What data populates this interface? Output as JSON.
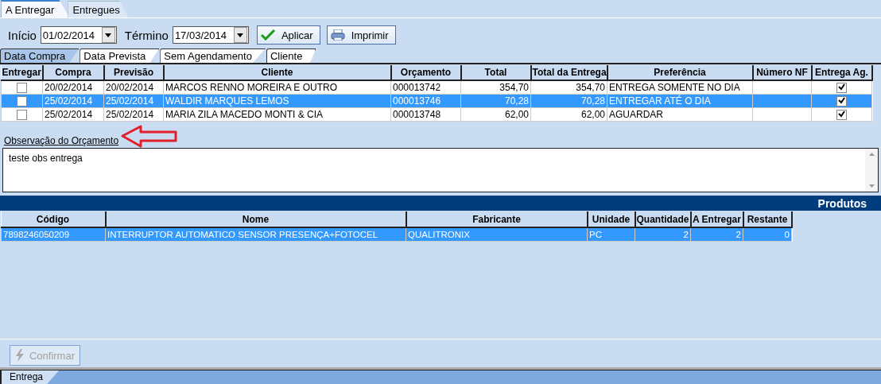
{
  "main_tabs": [
    {
      "label": "A Entregar",
      "selected": true
    },
    {
      "label": "Entregues",
      "selected": false
    }
  ],
  "filters": {
    "start_label": "Início",
    "start_value": "01/02/2014",
    "end_label": "Término",
    "end_value": "17/03/2014",
    "apply_button": "Aplicar",
    "print_button": "Imprimir"
  },
  "sort_tabs": [
    {
      "label": "Data Compra",
      "selected": true
    },
    {
      "label": "Data Prevista",
      "selected": false
    },
    {
      "label": "Sem Agendamento",
      "selected": false
    },
    {
      "label": "Cliente",
      "selected": false
    }
  ],
  "orders": {
    "columns": [
      "Entregar",
      "Compra",
      "Previsão",
      "Cliente",
      "Orçamento",
      "Total",
      "Total da Entrega",
      "Preferência",
      "Número NF",
      "Entrega Ag."
    ],
    "rows": [
      {
        "entregar": false,
        "compra": "20/02/2014",
        "previsao": "20/02/2014",
        "cliente": "MARCOS RENNO MOREIRA E OUTRO",
        "orcamento": "000013742",
        "total": "354,70",
        "total_entrega": "354,70",
        "preferencia": "ENTREGA SOMENTE NO DIA",
        "entrega_ag": true,
        "selected": false
      },
      {
        "entregar": false,
        "compra": "25/02/2014",
        "previsao": "25/02/2014",
        "cliente": "WALDIR MARQUES LEMOS",
        "orcamento": "000013746",
        "total": "70,28",
        "total_entrega": "70,28",
        "preferencia": "ENTREGAR ATÉ O DIA",
        "entrega_ag": true,
        "selected": true
      },
      {
        "entregar": false,
        "compra": "25/02/2014",
        "previsao": "25/02/2014",
        "cliente": "MARIA ZILA MACEDO MONTI & CIA",
        "orcamento": "000013748",
        "total": "62,00",
        "total_entrega": "62,00",
        "preferencia": "AGUARDAR",
        "entrega_ag": true,
        "selected": false
      }
    ]
  },
  "observation": {
    "label": "Observação do Orçamento",
    "value": "teste obs entrega"
  },
  "products": {
    "title": "Produtos",
    "columns": [
      "Código",
      "Nome",
      "Fabricante",
      "Unidade",
      "Quantidade",
      "A Entregar",
      "Restante"
    ],
    "rows": [
      {
        "cells": [
          "7898246050209",
          "INTERRUPTOR AUTOMATICO SENSOR PRESENÇA+FOTOCEL",
          "QUALITRONIX",
          "PC",
          "2",
          "2",
          "0"
        ],
        "selected": true
      }
    ]
  },
  "confirm_button": {
    "label": "Confirmar",
    "disabled": true
  },
  "bottom_tabs": [
    {
      "label": "Entrega",
      "selected": true
    }
  ]
}
